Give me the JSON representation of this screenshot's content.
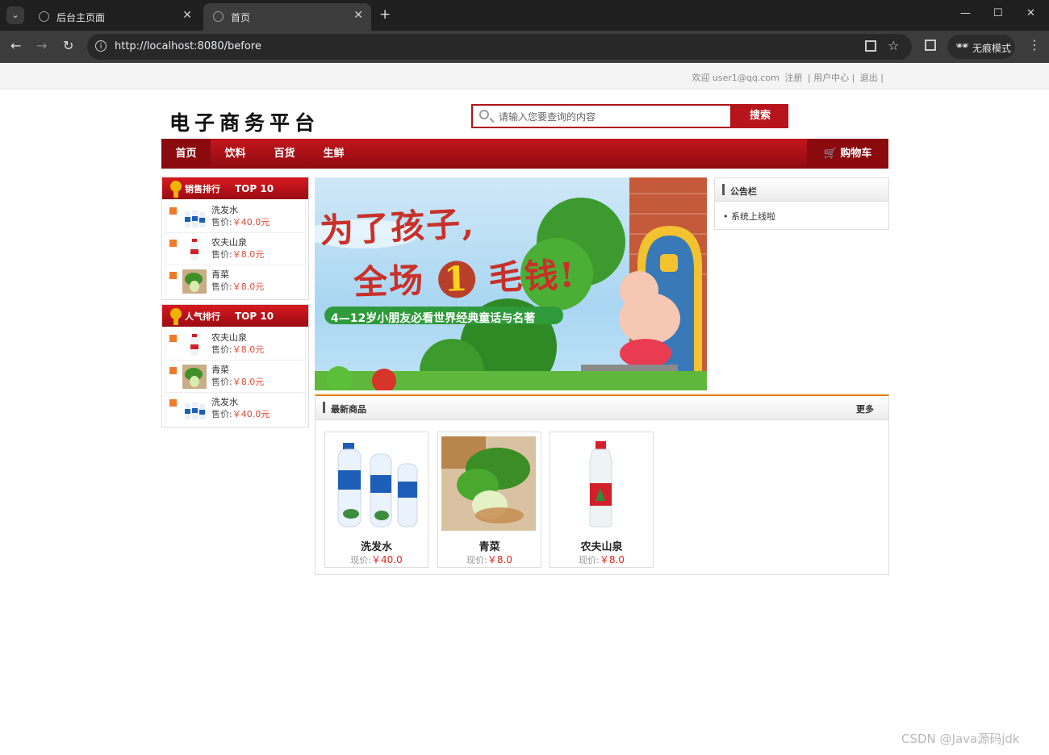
{
  "browser": {
    "tabs": [
      {
        "title": "后台主页面"
      },
      {
        "title": "首页"
      }
    ],
    "url": "http://localhost:8080/before",
    "incognito_label": "无痕模式"
  },
  "topbar": {
    "welcome": "欢迎 user1@qq.com",
    "register": "注册",
    "user_center": "| 用户中心 |",
    "logout": "退出 |"
  },
  "header": {
    "logo": "电子商务平台",
    "search_placeholder": "请输入您要查询的内容",
    "search_button": "搜索"
  },
  "nav": {
    "items": [
      "首页",
      "饮料",
      "百货",
      "生鲜"
    ],
    "active": "首页",
    "cart": "购物车"
  },
  "sales_rank": {
    "title": "销售排行",
    "top": "TOP 10",
    "items": [
      {
        "name": "洗发水",
        "price_label": "售价:",
        "price": "￥40.0元"
      },
      {
        "name": "农夫山泉",
        "price_label": "售价:",
        "price": "￥8.0元"
      },
      {
        "name": "青菜",
        "price_label": "售价:",
        "price": "￥8.0元"
      }
    ]
  },
  "popular_rank": {
    "title": "人气排行",
    "top": "TOP 10",
    "items": [
      {
        "name": "农夫山泉",
        "price_label": "售价:",
        "price": "￥8.0元"
      },
      {
        "name": "青菜",
        "price_label": "售价:",
        "price": "￥8.0元"
      },
      {
        "name": "洗发水",
        "price_label": "售价:",
        "price": "￥40.0元"
      }
    ]
  },
  "banner": {
    "line1": "为了孩子,",
    "line2a": "全场",
    "line2b": "1",
    "line2c": "毛钱!",
    "line3": "4—12岁小朋友必看世界经典童话与名著"
  },
  "notice": {
    "title": "公告栏",
    "items": [
      "系统上线啦"
    ]
  },
  "new_products": {
    "title": "最新商品",
    "more": "更多",
    "items": [
      {
        "name": "洗发水",
        "price_label": "现价:",
        "price": "￥40.0"
      },
      {
        "name": "青菜",
        "price_label": "现价:",
        "price": "￥8.0"
      },
      {
        "name": "农夫山泉",
        "price_label": "现价:",
        "price": "￥8.0"
      }
    ]
  },
  "watermark": "CSDN @Java源码jdk"
}
